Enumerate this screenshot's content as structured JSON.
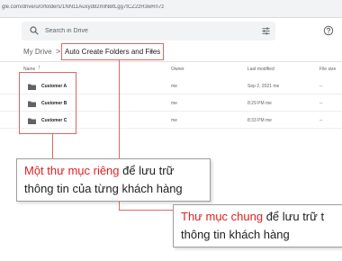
{
  "browser": {
    "url": "gle.com/drive/u/0/folders/1NN11Auxyd82mlNBtLgg7tCZ2zH3wRn7z"
  },
  "search": {
    "placeholder": "Search in Drive"
  },
  "breadcrumb": {
    "root": "My Drive",
    "separator": ">",
    "current": "Auto Create Folders and Files",
    "caret": "▾"
  },
  "table": {
    "headers": {
      "name": "Name",
      "sort": "↑",
      "owner": "Owner",
      "modified": "Last modified",
      "size": "File size"
    },
    "rows": [
      {
        "name": "Customer A",
        "owner": "me",
        "modified": "Sep 2, 2021 me",
        "size": "--"
      },
      {
        "name": "Customer B",
        "owner": "me",
        "modified": "8:29 PM me",
        "size": "--"
      },
      {
        "name": "Customer C",
        "owner": "me",
        "modified": "8:33 PM me",
        "size": "--"
      }
    ]
  },
  "annotations": {
    "private": {
      "red": "Một thư mục riêng",
      "rest1": " để lưu trữ",
      "line2": "thông tin của từng khách hàng"
    },
    "shared": {
      "red": "Thư mục chung",
      "rest1": " để lưu trữ t",
      "line2": "thông tin khách hàng"
    }
  },
  "colors": {
    "highlight": "#e06666",
    "callout_red": "#e02020",
    "folder": "#5f6368"
  },
  "icons": [
    "search-icon",
    "tune-icon",
    "help-icon",
    "folder-icon"
  ]
}
